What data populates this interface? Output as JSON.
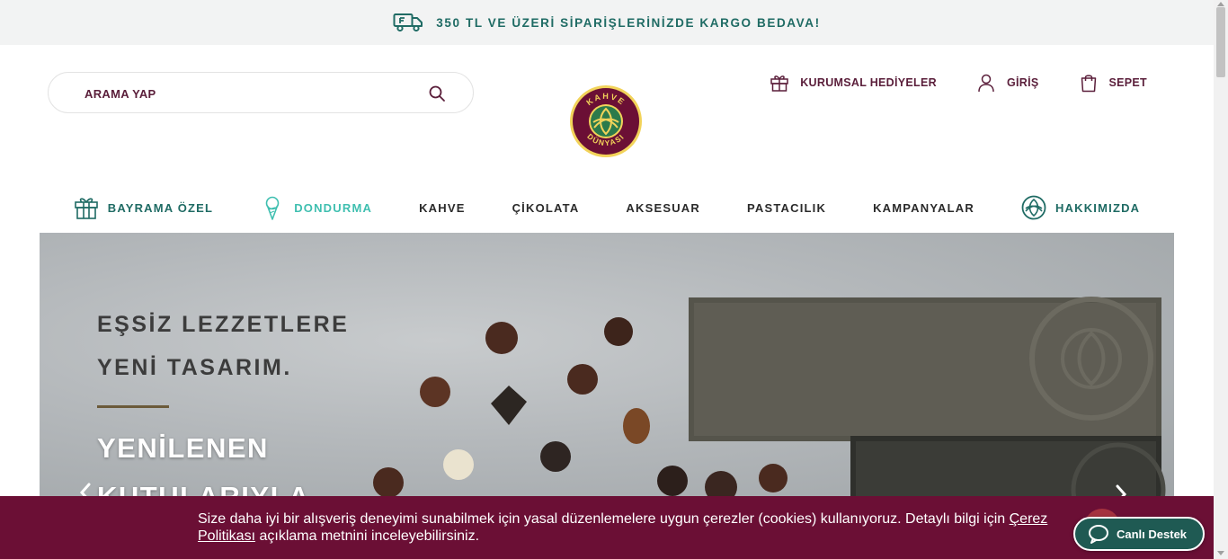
{
  "promo": {
    "text": "350 TL VE ÜZERİ SİPARİŞLERİNİZDE KARGO BEDAVA!",
    "icon": "delivery-truck-icon"
  },
  "search": {
    "placeholder": "ARAMA YAP",
    "value": "",
    "icon": "search-icon"
  },
  "logo": {
    "top_text": "KAHVE",
    "bottom_text": "DÜNYASI",
    "colors": {
      "ring": "#6b0f35",
      "outline": "#f2d35a",
      "center": "#2c7a4b"
    }
  },
  "header": {
    "links": [
      {
        "label": "KURUMSAL HEDİYELER",
        "icon": "gift-icon"
      },
      {
        "label": "GİRİŞ",
        "icon": "user-icon"
      },
      {
        "label": "SEPET",
        "icon": "cart-icon"
      }
    ]
  },
  "nav": {
    "items": [
      {
        "label": "BAYRAMA ÖZEL",
        "icon": "gift-box-icon",
        "color": "#1f6b64"
      },
      {
        "label": "DONDURMA",
        "icon": "ice-cream-icon",
        "color": "#3fbfb0"
      },
      {
        "label": "KAHVE",
        "color": "#2a2a2a"
      },
      {
        "label": "ÇİKOLATA",
        "color": "#2a2a2a"
      },
      {
        "label": "AKSESUAR",
        "color": "#2a2a2a"
      },
      {
        "label": "PASTACILIK",
        "color": "#2a2a2a"
      },
      {
        "label": "KAMPANYALAR",
        "color": "#2a2a2a"
      },
      {
        "label": "HAKKIMIZDA",
        "icon": "brand-emblem-icon",
        "color": "#1f6b64"
      }
    ]
  },
  "hero": {
    "line1": "EŞSİZ LEZZETLERE",
    "line2": "YENİ TASARIM.",
    "line3": "YENİLENEN",
    "line4": "KUTULARIYLA"
  },
  "cookie": {
    "text_before": "Size daha iyi bir alışveriş deneyimi sunabilmek için yasal düzenlemelere uygun çerezler (cookies) kullanıyoruz. Detaylı bilgi için ",
    "link": "Çerez Politikası",
    "text_after": " açıklama metnini inceleyebilirsiniz."
  },
  "live_support": {
    "label": "Canlı Destek",
    "icon": "chat-bubble-icon"
  },
  "colors": {
    "brand_maroon": "#6b0f35",
    "brand_green": "#1f6b64",
    "accent_teal": "#3fbfb0"
  }
}
